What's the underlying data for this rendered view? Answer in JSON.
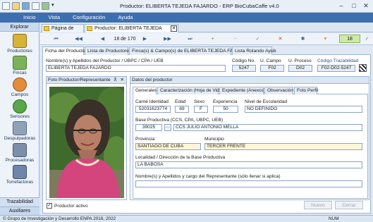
{
  "window": {
    "title": "Productor: ELIBERTA TEJEDA FAJARDO - ERP BioCubaCaffe v4.0"
  },
  "menu": [
    "Inicio",
    "Vista",
    "Configuración",
    "Ayuda"
  ],
  "sidebar": {
    "header": "Explorar",
    "items": [
      "Productores",
      "Fincas",
      "Campos",
      "Sensores",
      "Despulpadoras",
      "Procesadoras",
      "Torrefactoras"
    ],
    "trazabilidad": "Trazabilidad",
    "auxiliares": "Auxiliares"
  },
  "doc_tabs": {
    "home": "Página de Inicio",
    "current": "Productor: ELIBERTA TEJEDA FAJARDO"
  },
  "nav": {
    "record_counter": "18 de 170",
    "right_counter": "18"
  },
  "main_tabs": [
    "Ficha del Productor",
    "Lista de Productores",
    "Finca(s) & Campo(s) de ELIBERTA TEJEDA FAJARDO",
    "Lista Rolando Ayub"
  ],
  "header_fields": {
    "name_label": "Nombre(s) y Apellidos del Productor / UBPC / CPA / UEB",
    "name_value": "ELIBERTA TEJEDA FAJARDO",
    "codigo_label": "Código No.",
    "codigo_value": "5247",
    "campo_label": "U. Campo",
    "campo_value": "F02",
    "proceso_label": "U. Proceso",
    "proceso_value": "D02",
    "traz_label": "Código Trazabilidad",
    "traz_value": "F02-D02-5247"
  },
  "photo_panel": {
    "title": "Foto Productor/Representante",
    "pin": "⊼",
    "close": "✕"
  },
  "datos": {
    "title": "Datos del productor",
    "subtabs": [
      "Generales",
      "Caracterización (Hoja de Vida)",
      "Expediente (Anexos)",
      "Observación",
      "Foto Perfil"
    ],
    "carne_label": "Carné Identidad",
    "carne_value": "52031623774",
    "edad_label": "Edad",
    "edad_value": "69",
    "sexo_label": "Sexo",
    "sexo_value": "F",
    "exp_label": "Experiencia",
    "exp_value": "50",
    "escolaridad_label": "Nivel de Escolaridad",
    "escolaridad_value": "NO DEFINIDO",
    "base_label": "Base Productiva (CCS, CPA, UBPC, UEB)",
    "base_code": "39025",
    "base_name": "CCS JULIO ANTONIO MELLA",
    "provincia_label": "Provincia",
    "provincia_value": "SANTIAGO DE CUBA",
    "municipio_label": "Municipio",
    "municipio_value": "TERCER FRENTE",
    "localidad_label": "Localidad / Dirección de la Base Productiva",
    "localidad_value": "LA BABOSA",
    "rep_label": "Nombre(s) y Apellidos y cargo del Representante (sólo llenar si aplica)",
    "rep_value": ""
  },
  "footer": {
    "activo_label": "Productor activo",
    "nuevo": "Nuevo",
    "cerrar": "Cerrar"
  },
  "statusbar": {
    "copyright": "© Grupo de Investigación y Desarrollo ENPA 2016, 2022",
    "num": "NUM"
  }
}
